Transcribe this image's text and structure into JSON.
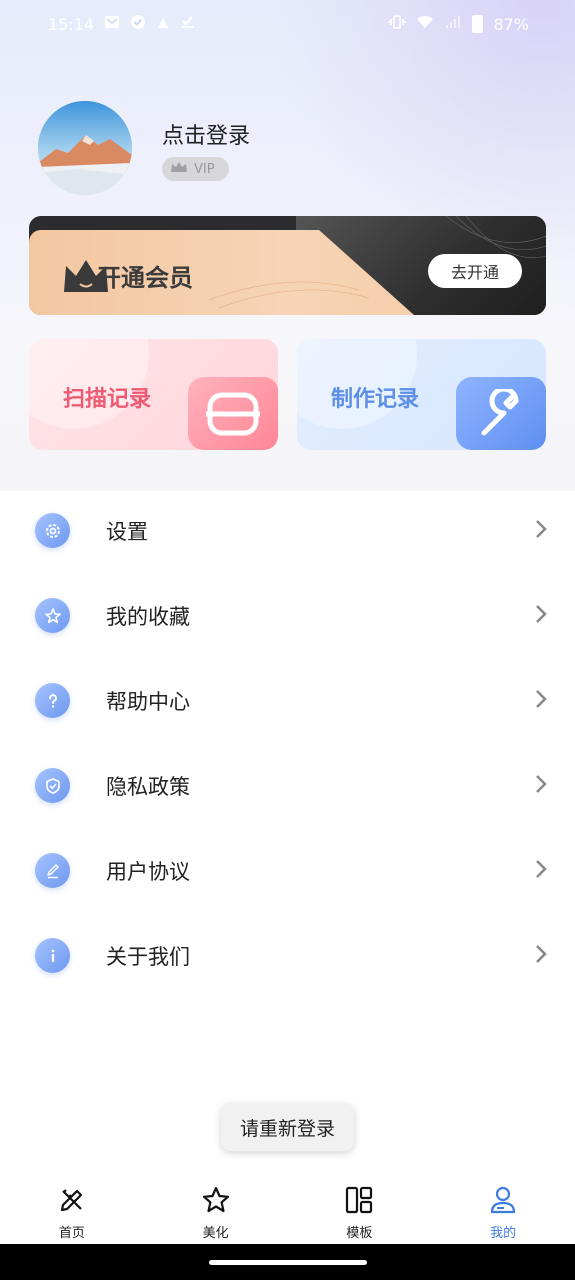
{
  "status_bar": {
    "time": "15:14",
    "battery": "87%"
  },
  "profile": {
    "login_prompt": "点击登录",
    "vip_badge": "VIP"
  },
  "vip_banner": {
    "title": "开通会员",
    "button": "去开通"
  },
  "cards": [
    {
      "label": "扫描记录",
      "icon": "scan-icon"
    },
    {
      "label": "制作记录",
      "icon": "wrench-icon"
    }
  ],
  "menu": [
    {
      "label": "设置",
      "icon": "gear-icon"
    },
    {
      "label": "我的收藏",
      "icon": "star-icon"
    },
    {
      "label": "帮助中心",
      "icon": "question-icon"
    },
    {
      "label": "隐私政策",
      "icon": "shield-icon"
    },
    {
      "label": "用户协议",
      "icon": "pen-icon"
    },
    {
      "label": "关于我们",
      "icon": "info-icon"
    }
  ],
  "toast": "请重新登录",
  "nav": [
    {
      "label": "首页",
      "icon": "pencil-ruler-icon"
    },
    {
      "label": "美化",
      "icon": "star-outline-icon"
    },
    {
      "label": "模板",
      "icon": "template-icon"
    },
    {
      "label": "我的",
      "icon": "user-icon",
      "active": true
    }
  ],
  "colors": {
    "accent": "#3d7be0",
    "scan": "#ee5a71",
    "make": "#5d8fe6"
  }
}
